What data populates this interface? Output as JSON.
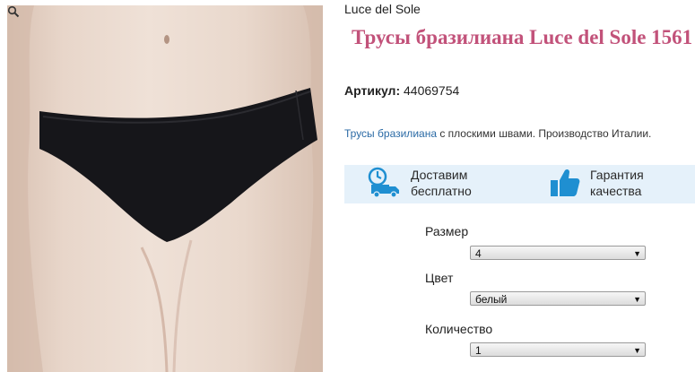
{
  "product": {
    "brand": "Luce del Sole",
    "title": "Трусы бразилиана Luce del Sole 1561",
    "sku_label": "Артикул:",
    "sku_value": "44069754",
    "description_link": "Трусы бразилиана",
    "description_rest": " с плоскими швами. Производство Италии."
  },
  "benefits": [
    {
      "line1": "Доставим",
      "line2": "бесплатно",
      "icon": "truck-clock-icon"
    },
    {
      "line1": "Гарантия",
      "line2": "качества",
      "icon": "thumbs-up-icon"
    }
  ],
  "options": {
    "size_label": "Размер",
    "size_value": "4",
    "color_label": "Цвет",
    "color_value": "белый",
    "quantity_label": "Количество",
    "quantity_value": "1"
  },
  "colors": {
    "title": "#c2527a",
    "link": "#2a6aa5",
    "benefit_bg": "#e5f1fa",
    "icon_blue": "#1f8fd1"
  }
}
